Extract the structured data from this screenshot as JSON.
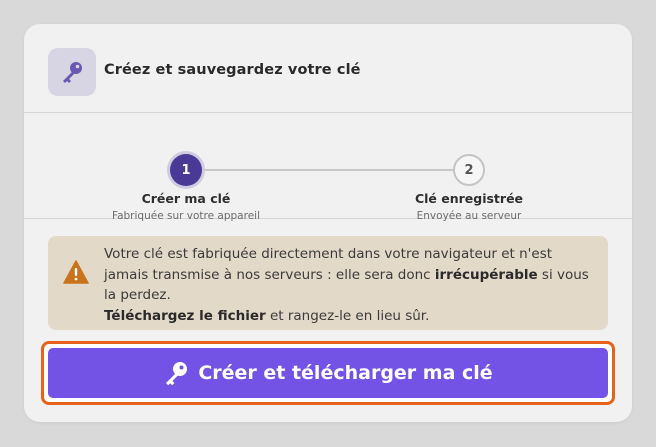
{
  "colors": {
    "backdrop": "#d9d9d9",
    "card": "#f1f1f1",
    "accent_dark": "#4b3996",
    "accent": "#7352e6",
    "focus_ring": "#e8631a",
    "warning_bg": "#e3d9c9",
    "warning_icon": "#c9731a"
  },
  "header": {
    "icon": "key-icon",
    "title": "Créez et sauvegardez votre clé"
  },
  "stepper": {
    "current_step": 1,
    "steps": [
      {
        "number": "1",
        "label": "Créer ma clé",
        "sublabel": "Fabriquée sur votre appareil",
        "state": "active"
      },
      {
        "number": "2",
        "label": "Clé enregistrée",
        "sublabel": "Envoyée au serveur",
        "state": "inactive"
      }
    ]
  },
  "warning": {
    "icon": "warning-triangle-icon",
    "line1_text": "Votre clé est fabriquée directement dans votre navigateur et n'est jamais transmise à nos serveurs : elle sera donc ",
    "line1_strong": "irrécupérable",
    "line1_tail": " si vous la perdez.",
    "line2_strong": "Téléchargez le fichier",
    "line2_tail": " et rangez-le en lieu sûr."
  },
  "cta": {
    "icon": "key-icon",
    "label": "Créer et télécharger ma clé"
  }
}
